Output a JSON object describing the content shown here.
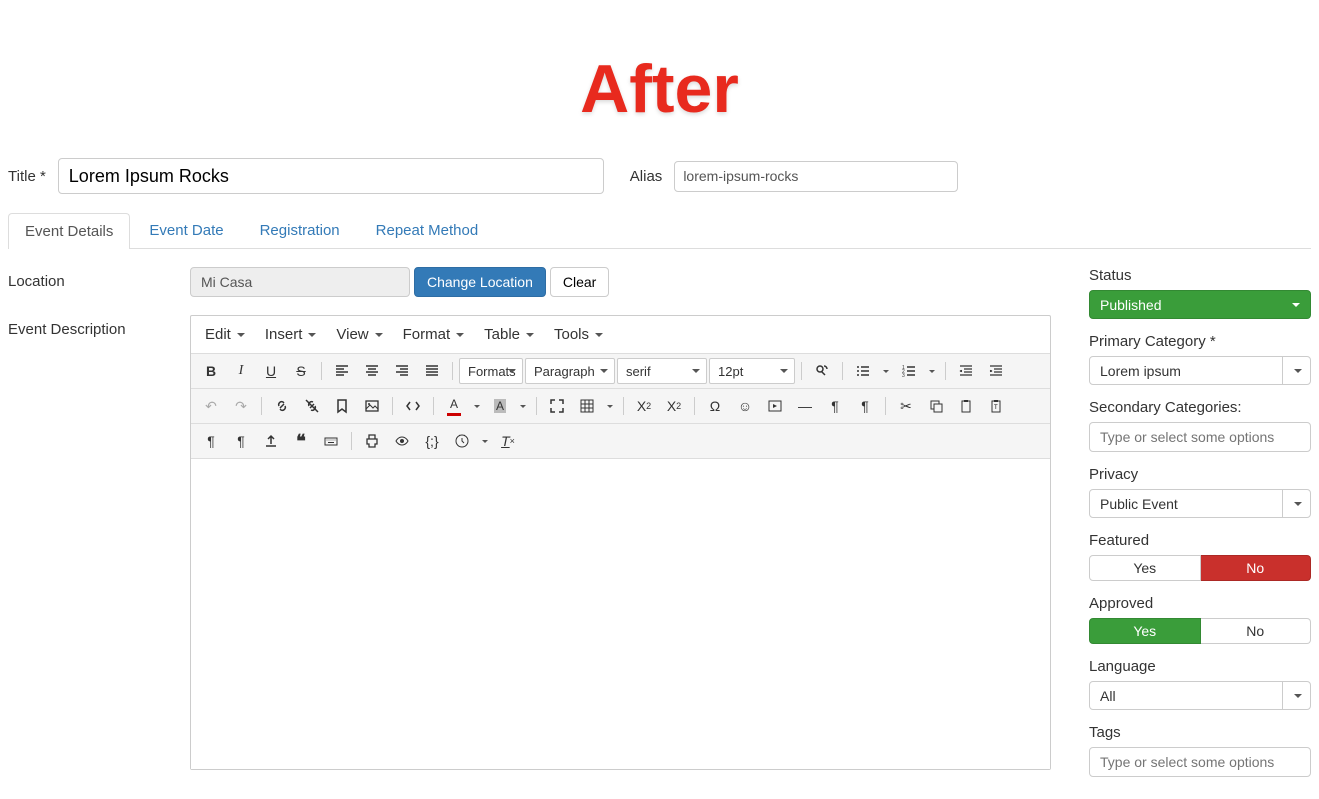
{
  "header": {
    "title": "After"
  },
  "form": {
    "title_label": "Title *",
    "title_value": "Lorem Ipsum Rocks",
    "alias_label": "Alias",
    "alias_value": "lorem-ipsum-rocks"
  },
  "tabs": [
    {
      "label": "Event Details",
      "active": true
    },
    {
      "label": "Event Date",
      "active": false
    },
    {
      "label": "Registration",
      "active": false
    },
    {
      "label": "Repeat Method",
      "active": false
    }
  ],
  "location": {
    "label": "Location",
    "value": "Mi Casa",
    "change_btn": "Change Location",
    "clear_btn": "Clear"
  },
  "description": {
    "label": "Event Description"
  },
  "editor_menu": [
    "Edit",
    "Insert",
    "View",
    "Format",
    "Table",
    "Tools"
  ],
  "editor_toolbar": {
    "formats": "Formats",
    "block": "Paragraph",
    "font": "serif",
    "size": "12pt"
  },
  "sidebar": {
    "status": {
      "label": "Status",
      "value": "Published"
    },
    "primary_cat": {
      "label": "Primary Category *",
      "value": "Lorem ipsum"
    },
    "secondary_cat": {
      "label": "Secondary Categories:",
      "placeholder": "Type or select some options"
    },
    "privacy": {
      "label": "Privacy",
      "value": "Public Event"
    },
    "featured": {
      "label": "Featured",
      "yes": "Yes",
      "no": "No",
      "active": "no"
    },
    "approved": {
      "label": "Approved",
      "yes": "Yes",
      "no": "No",
      "active": "yes"
    },
    "language": {
      "label": "Language",
      "value": "All"
    },
    "tags": {
      "label": "Tags",
      "placeholder": "Type or select some options"
    }
  }
}
